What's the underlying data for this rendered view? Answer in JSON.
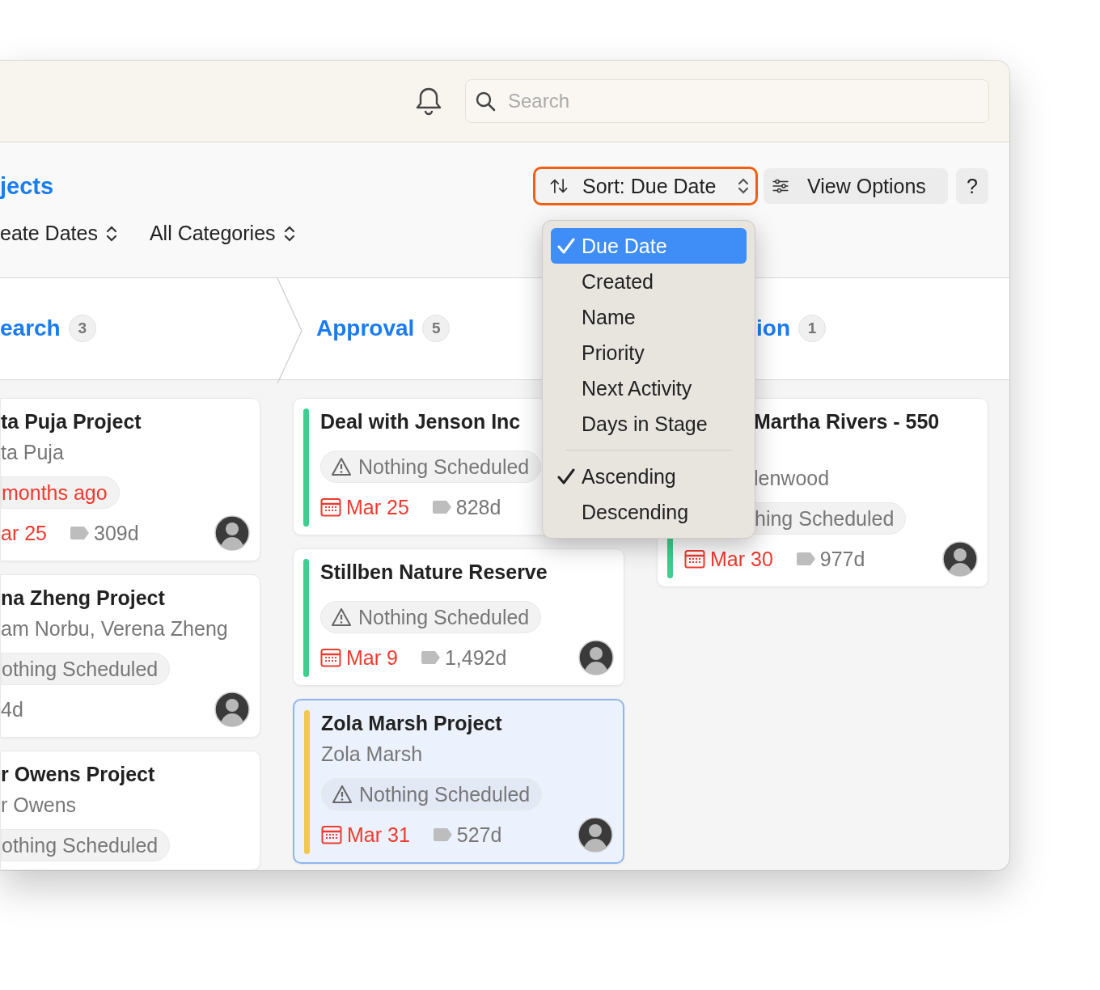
{
  "titlebar": {
    "search": {
      "placeholder": "Search"
    }
  },
  "header": {
    "title": "jects",
    "sort_button": {
      "label": "Sort: Due Date",
      "focused": true
    },
    "view_options": "View Options",
    "help": "?"
  },
  "filters": [
    {
      "label": "eate Dates"
    },
    {
      "label": "All Categories"
    }
  ],
  "stages": [
    {
      "name": "earch",
      "count": "3"
    },
    {
      "name": "Approval",
      "count": "5"
    },
    {
      "name": "ion",
      "count": "1"
    }
  ],
  "columns": [
    {
      "cards": [
        {
          "title": "ta Puja Project",
          "subtitle": "ta Puja",
          "activity": {
            "text": "months ago",
            "overdue": true,
            "icon": false
          },
          "due": {
            "text": "ar 25",
            "icon": false
          },
          "days": {
            "text": "309d",
            "icon": true
          },
          "avatar": true,
          "selected": false
        },
        {
          "title": "na Zheng Project",
          "subtitle": "am Norbu, Verena Zheng",
          "activity": {
            "text": "othing Scheduled",
            "overdue": false,
            "icon": false
          },
          "days": {
            "text": "4d",
            "icon": false
          },
          "avatar": true,
          "selected": false
        },
        {
          "title": "r Owens Project",
          "subtitle": "r Owens",
          "activity": {
            "text": "othing Scheduled",
            "overdue": false,
            "icon": false
          },
          "selected": false
        }
      ]
    },
    {
      "cards": [
        {
          "title": "Deal with Jenson Inc",
          "color": "#3ecf8e",
          "activity": {
            "text": "Nothing Scheduled",
            "overdue": false,
            "icon": true
          },
          "due": {
            "text": "Mar 25",
            "icon": true
          },
          "days": {
            "text": "828d",
            "icon": true
          },
          "avatar": false,
          "selected": false
        },
        {
          "title": "Stillben Nature Reserve",
          "color": "#3ecf8e",
          "activity": {
            "text": "Nothing Scheduled",
            "overdue": false,
            "icon": true
          },
          "due": {
            "text": "Mar 9",
            "icon": true
          },
          "days": {
            "text": "1,492d",
            "icon": true
          },
          "avatar": true,
          "selected": false
        },
        {
          "title": "Zola Marsh Project",
          "subtitle": "Zola Marsh",
          "color": "#f2c94c",
          "activity": {
            "text": "Nothing Scheduled",
            "overdue": false,
            "icon": true
          },
          "due": {
            "text": "Mar 31",
            "icon": true
          },
          "days": {
            "text": "527d",
            "icon": true
          },
          "avatar": true,
          "selected": true
        }
      ]
    },
    {
      "cards": [
        {
          "title": "Martha Rivers - 550",
          "subtitle": "lenwood",
          "color": "#3ecf8e",
          "activity": {
            "text": "hing Scheduled",
            "overdue": false,
            "icon": false
          },
          "due": {
            "text": "Mar 30",
            "icon": true
          },
          "days": {
            "text": "977d",
            "icon": true
          },
          "avatar": true,
          "selected": false
        }
      ]
    }
  ],
  "sort_menu": {
    "fields": [
      {
        "label": "Due Date",
        "selected": true,
        "highlighted": true
      },
      {
        "label": "Created",
        "selected": false,
        "highlighted": false
      },
      {
        "label": "Name",
        "selected": false,
        "highlighted": false
      },
      {
        "label": "Priority",
        "selected": false,
        "highlighted": false
      },
      {
        "label": "Next Activity",
        "selected": false,
        "highlighted": false
      },
      {
        "label": "Days in Stage",
        "selected": false,
        "highlighted": false
      }
    ],
    "order": [
      {
        "label": "Ascending",
        "selected": true
      },
      {
        "label": "Descending",
        "selected": false
      }
    ]
  }
}
